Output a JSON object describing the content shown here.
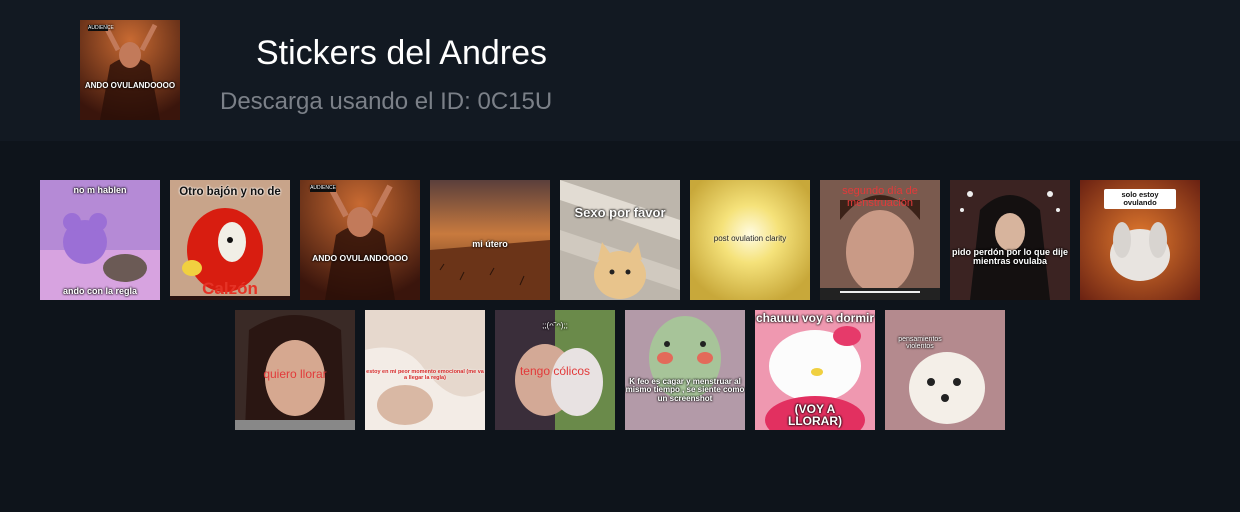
{
  "header": {
    "title": "Stickers del Andres",
    "subtitle": "Descarga usando el ID: 0C15U"
  },
  "stickers": [
    {
      "top": "no m hablen",
      "bottom": "ando con la regla"
    },
    {
      "top": "Otro bajón y no de",
      "bottom": "Calzón"
    },
    {
      "badge": "AUDIENCE",
      "caption": "ANDO OVULANDOOOO"
    },
    {
      "caption": "mi útero"
    },
    {
      "caption": "Sexo por favor"
    },
    {
      "caption": "post ovulation clarity"
    },
    {
      "caption": "segundo día de menstruación"
    },
    {
      "caption": "pido perdón por lo que dije mientras ovulaba"
    },
    {
      "caption": "solo estoy ovulando"
    },
    {
      "caption": "quiero llorar"
    },
    {
      "caption": "estoy en mi peor momento emocional (me va a llegar la regla)"
    },
    {
      "top": ";;(ᴖ˜ᴖ);;",
      "caption": "tengo cólicos"
    },
    {
      "caption": "K feo es cagar y menstruar al mismo tiempo , se siente como un screenshot"
    },
    {
      "top": "chauuu voy a dormir",
      "bottom": "(VOY A LLORAR)"
    },
    {
      "caption": "pensamientos violentos"
    }
  ]
}
